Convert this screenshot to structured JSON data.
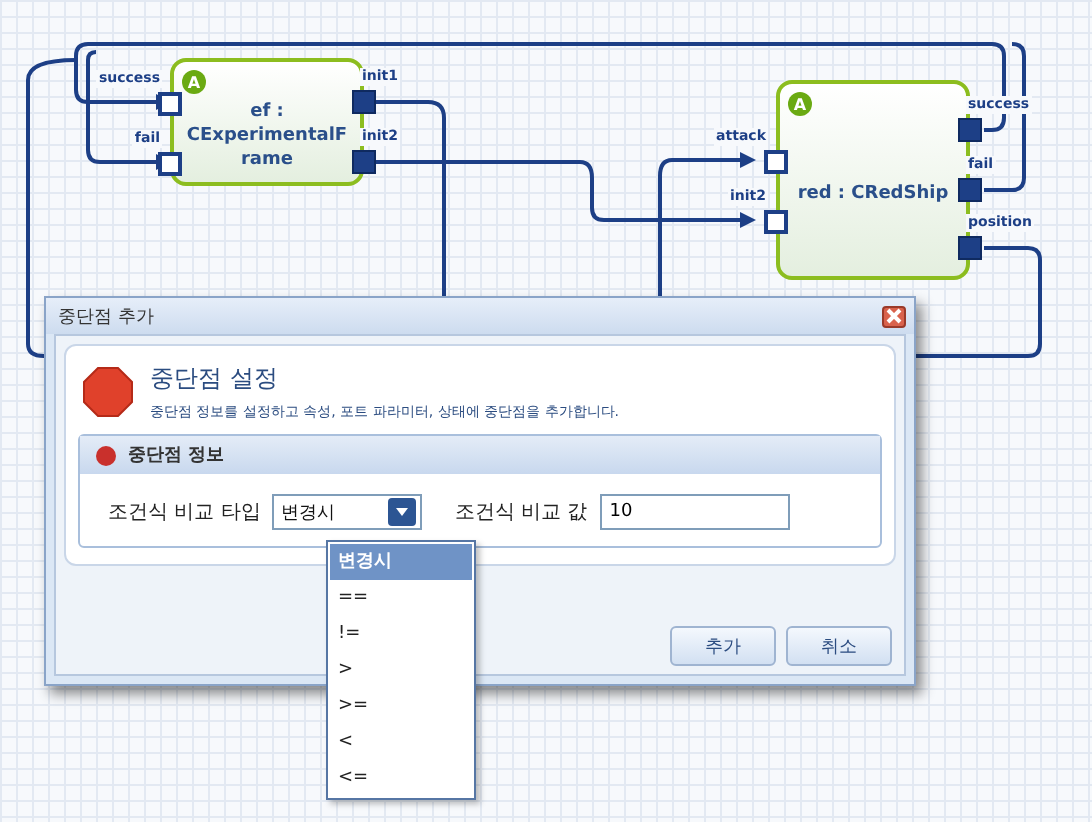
{
  "canvas": {
    "nodes": [
      {
        "name_lines": [
          "ef :",
          "CExperimentalF",
          "rame"
        ],
        "badge": "A",
        "ports": [
          {
            "label": "success",
            "kind": "in"
          },
          {
            "label": "fail",
            "kind": "in"
          },
          {
            "label": "init1",
            "kind": "out"
          },
          {
            "label": "init2",
            "kind": "out"
          }
        ]
      },
      {
        "name_lines": [
          "red : CRedShip"
        ],
        "badge": "A",
        "ports": [
          {
            "label": "attack",
            "kind": "in"
          },
          {
            "label": "init2",
            "kind": "in"
          },
          {
            "label": "success",
            "kind": "out"
          },
          {
            "label": "fail",
            "kind": "out"
          },
          {
            "label": "position",
            "kind": "out"
          }
        ]
      }
    ]
  },
  "dialog": {
    "title": "중단점 추가",
    "heading": "중단점 설정",
    "description": "중단점 정보를 설정하고 속성, 포트 파라미터, 상태에 중단점을 추가합니다.",
    "group_title": "중단점 정보",
    "type_label": "조건식 비교 타입",
    "type_value": "변경시",
    "value_label": "조건식 비교 값",
    "value": "10",
    "options": [
      {
        "label": "변경시",
        "selected": true
      },
      {
        "label": "==",
        "selected": false
      },
      {
        "label": "!=",
        "selected": false
      },
      {
        "label": ">",
        "selected": false
      },
      {
        "label": ">=",
        "selected": false
      },
      {
        "label": "<",
        "selected": false
      },
      {
        "label": "<=",
        "selected": false
      }
    ],
    "buttons": [
      "추가",
      "취소"
    ]
  }
}
